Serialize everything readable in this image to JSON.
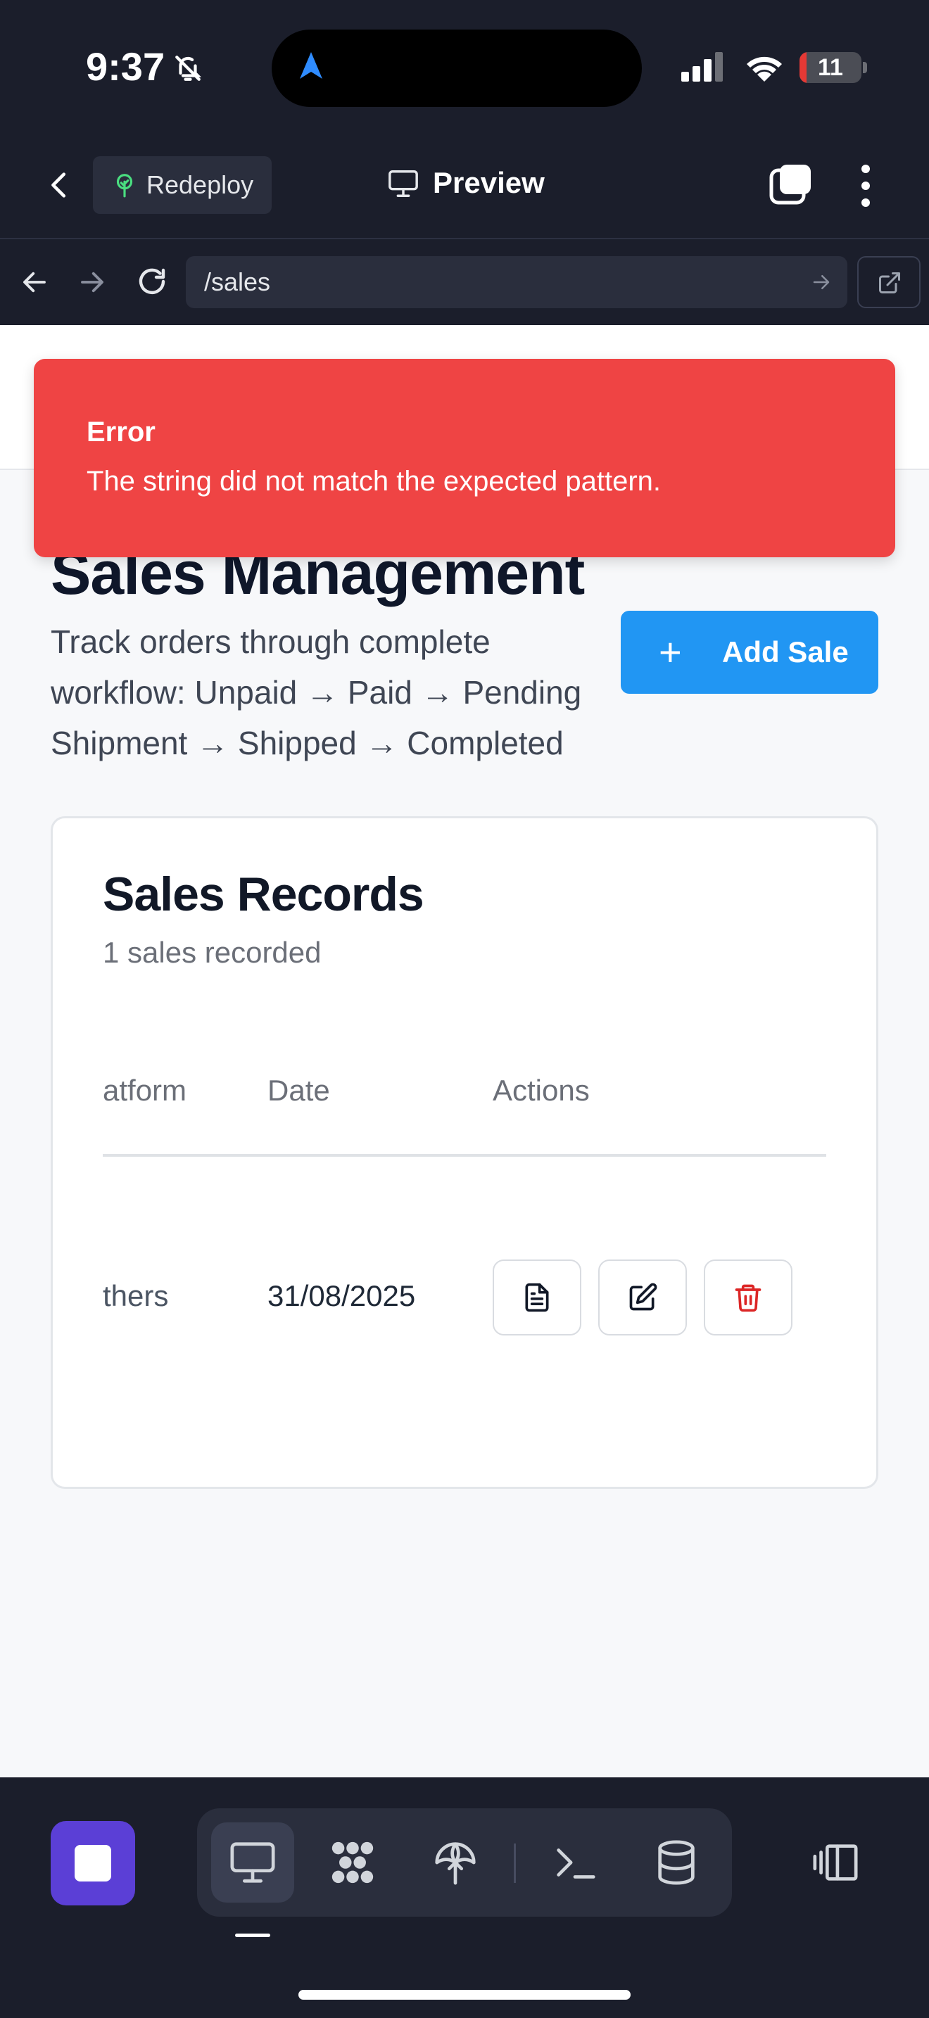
{
  "status_bar": {
    "time": "9:37",
    "battery_level": "11",
    "battery_fraction": 0.11,
    "icons": [
      "bell-slash-icon",
      "location-arrow-icon",
      "cellular-signal-icon",
      "wifi-icon",
      "battery-icon"
    ]
  },
  "app_toolbar": {
    "back_icon": "chevron-left-icon",
    "redeploy_label": "Redeploy",
    "preview_label": "Preview",
    "icons": [
      "tree-icon",
      "monitor-icon",
      "tabs-icon",
      "more-vertical-icon"
    ]
  },
  "browser": {
    "url": "/sales",
    "icons": [
      "arrow-left-icon",
      "arrow-right-icon",
      "reload-icon",
      "go-arrow-icon",
      "external-link-icon"
    ]
  },
  "toast": {
    "title": "Error",
    "message": "The string did not match the expected pattern."
  },
  "page": {
    "title": "Sales Management",
    "subtitle": "Track orders through complete workflow: Unpaid → Paid → Pending Shipment → Shipped → Completed",
    "add_button_label": "Add Sale",
    "add_button_icon": "+"
  },
  "records": {
    "title": "Sales Records",
    "count_text": "1 sales recorded",
    "columns": [
      "atform",
      "Date",
      "Actions"
    ],
    "rows": [
      {
        "platform": "thers",
        "date": "31/08/2025",
        "actions": [
          "document-icon",
          "edit-icon",
          "trash-icon"
        ]
      }
    ]
  },
  "bottom_bar": {
    "icons": [
      "stop-icon",
      "monitor-icon",
      "packages-icon",
      "deploy-icon",
      "terminal-icon",
      "database-icon",
      "panel-toggle-icon"
    ]
  },
  "colors": {
    "chrome_bg": "#1b1e2b",
    "toast_red": "#ef4444",
    "primary_blue": "#2196f3",
    "stop_purple": "#5b3fd6",
    "delete_red": "#dc2626"
  }
}
